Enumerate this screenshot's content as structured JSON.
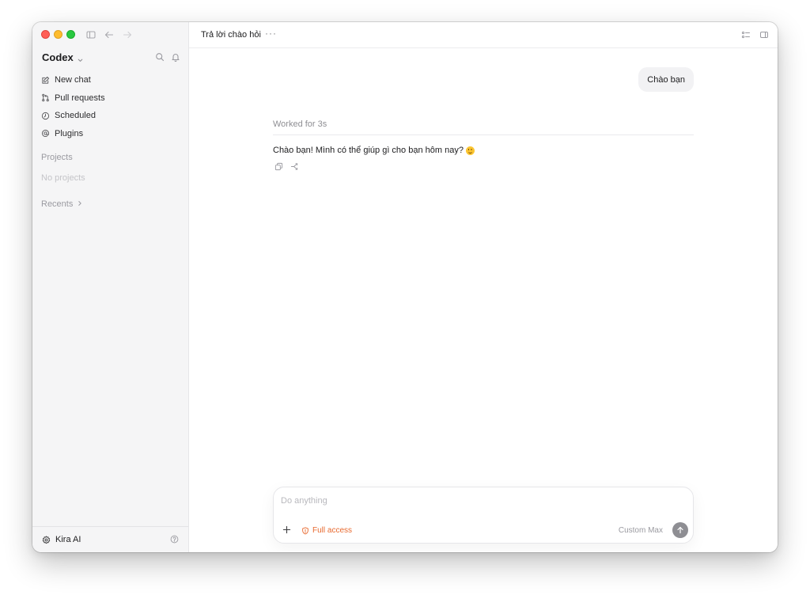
{
  "sidebar": {
    "brand": "Codex",
    "nav": [
      {
        "label": "New chat",
        "icon": "edit-icon"
      },
      {
        "label": "Pull requests",
        "icon": "pull-request-icon"
      },
      {
        "label": "Scheduled",
        "icon": "clock-icon"
      },
      {
        "label": "Plugins",
        "icon": "at-sign-icon"
      }
    ],
    "projects_label": "Projects",
    "no_projects": "No projects",
    "recents_label": "Recents",
    "user_name": "Kira AI"
  },
  "topbar": {
    "thread_title": "Trả lời chào hỏi",
    "more": "···"
  },
  "conversation": {
    "user_message": "Chào bạn",
    "worked_for": "Worked for 3s",
    "assistant_reply": "Chào bạn! Mình có thể giúp gì cho bạn hôm nay?"
  },
  "composer": {
    "placeholder": "Do anything",
    "access_label": "Full access",
    "model_label": "Custom Max"
  },
  "colors": {
    "sidebar_bg": "#f5f5f6",
    "accent_orange": "#e8692e",
    "send_button": "#8e8e93"
  }
}
